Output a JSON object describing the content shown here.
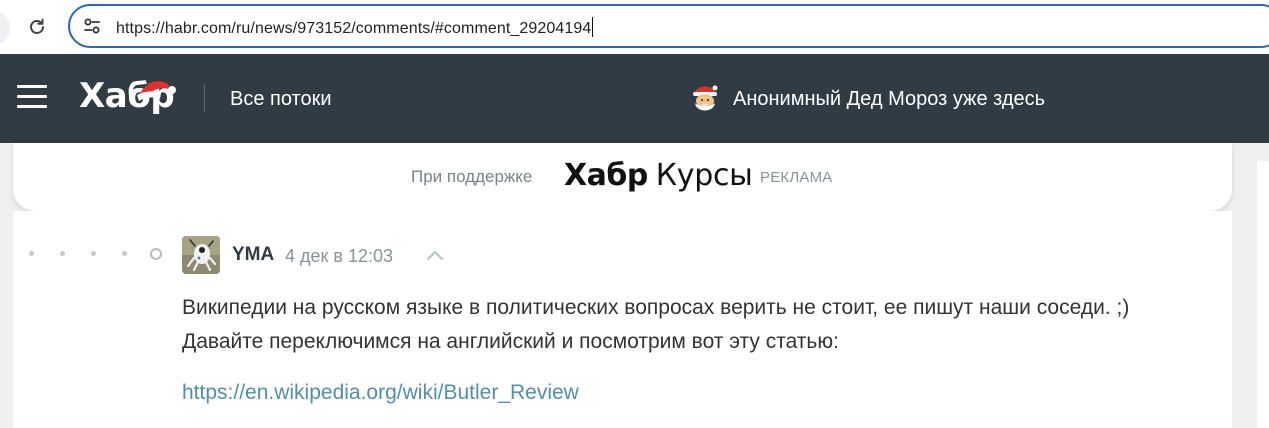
{
  "browser": {
    "url": "https://habr.com/ru/news/973152/comments/#comment_29204194"
  },
  "header": {
    "logo": "Хабр",
    "flows_label": "Все потоки",
    "santa_label": "Анонимный Дед Мороз уже здесь"
  },
  "sponsor": {
    "label": "При поддержке",
    "logo_bold": "Хабр",
    "logo_regular": "Курсы",
    "ad_label": "РЕКЛАМА"
  },
  "comment": {
    "author": "YMA",
    "date": "4 дек в 12:03",
    "text": "Википедии на русском языке в политических вопросах верить не стоит, ее пишут наши соседи. ;) Давайте переключимся на английский и посмотрим вот эту статью:",
    "link": "https://en.wikipedia.org/wiki/Butler_Review"
  },
  "icons": {
    "reload": "reload-icon",
    "site_info": "tune-icon",
    "menu": "hamburger-icon",
    "santa_hat": "santa-hat-icon",
    "santa_face": "santa-face-icon",
    "collapse": "chevron-up-icon"
  },
  "colors": {
    "header_bg": "#303b44",
    "address_border": "#2f62c6",
    "link": "#548eaa",
    "muted": "#8a9298"
  }
}
